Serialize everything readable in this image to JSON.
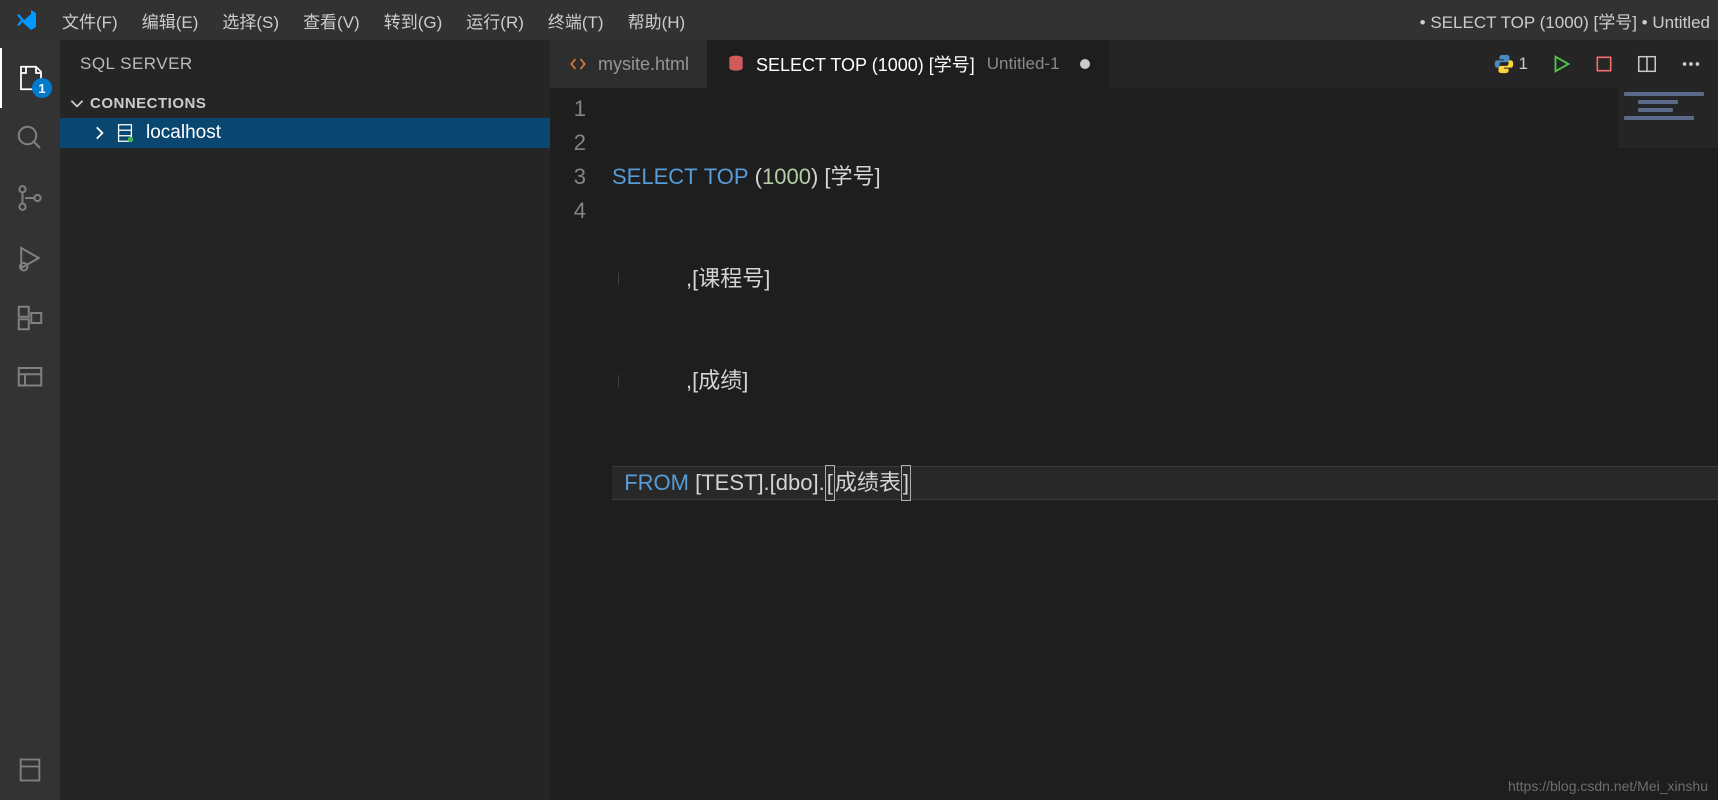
{
  "menu": {
    "items": [
      "文件(F)",
      "编辑(E)",
      "选择(S)",
      "查看(V)",
      "转到(G)",
      "运行(R)",
      "终端(T)",
      "帮助(H)"
    ]
  },
  "window_title": "• SELECT TOP (1000) [学号] • Untitled",
  "activity": {
    "explorer_badge": "1"
  },
  "sidebar": {
    "title": "SQL SERVER",
    "section": "CONNECTIONS",
    "connection": "localhost"
  },
  "tabs": {
    "0": {
      "label": "mysite.html"
    },
    "1": {
      "label": "SELECT TOP (1000) [学号]",
      "desc": "Untitled-1"
    }
  },
  "actions": {
    "interpreter_count": "1"
  },
  "editor": {
    "ln1": "1",
    "ln2": "2",
    "ln3": "3",
    "ln4": "4",
    "kw_select": "SELECT",
    "kw_top": "TOP",
    "paren_open": "(",
    "num_1000": "1000",
    "paren_close": ")",
    "col1": " [学号]",
    "comma2": ",",
    "col2": "[课程号]",
    "comma3": ",",
    "col3": "[成绩]",
    "kw_from": "FROM",
    "tbl": " [TEST].[dbo].",
    "br_open": "[",
    "tbl2": "成绩表",
    "br_close": "]"
  },
  "watermark": "https://blog.csdn.net/Mei_xinshu"
}
